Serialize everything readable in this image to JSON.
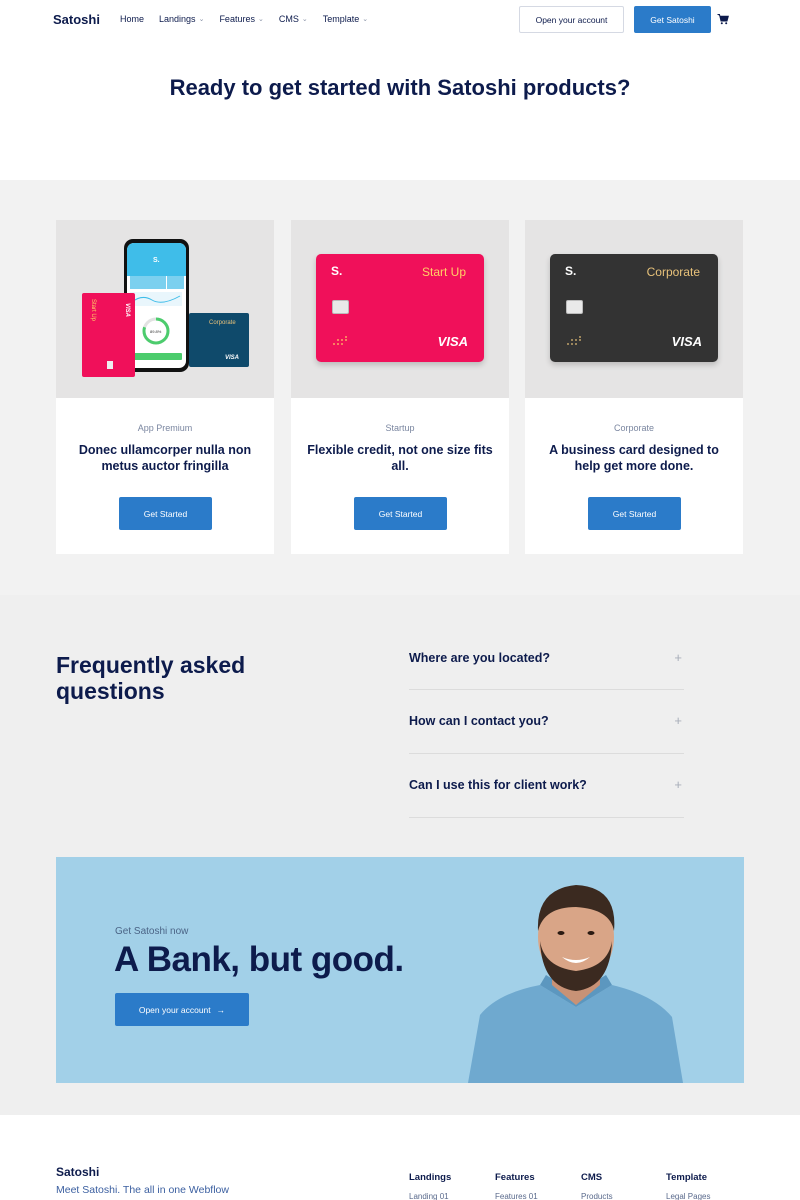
{
  "nav": {
    "brand": "Satoshi",
    "items": [
      {
        "label": "Home",
        "dropdown": false
      },
      {
        "label": "Landings",
        "dropdown": true
      },
      {
        "label": "Features",
        "dropdown": true
      },
      {
        "label": "CMS",
        "dropdown": true
      },
      {
        "label": "Template",
        "dropdown": true
      }
    ],
    "open_account": "Open your account",
    "get_satoshi": "Get Satoshi",
    "cart_icon": "cart-icon"
  },
  "hero": {
    "title": "Ready to get started with Satoshi products?"
  },
  "products": [
    {
      "eyebrow": "App Premium",
      "title": "Donec ullamcorper nulla non metus auctor fringilla",
      "button": "Get Started"
    },
    {
      "eyebrow": "Startup",
      "title": "Flexible credit, not one size fits all.",
      "button": "Get Started",
      "card": {
        "logo": "S.",
        "label": "Start Up",
        "network": "VISA",
        "color": "#f0105a",
        "label_color": "#ffd166"
      }
    },
    {
      "eyebrow": "Corporate",
      "title": "A business card designed to help get more done.",
      "button": "Get Started",
      "card": {
        "logo": "S.",
        "label": "Corporate",
        "network": "VISA",
        "color": "#333333",
        "label_color": "#e8c27a"
      }
    }
  ],
  "app_premium_image": {
    "phone_logo": "S.",
    "phone_percent": "89.8%",
    "pink_card_label": "Start Up",
    "pink_card_network": "VISA",
    "teal_card_label": "Corporate",
    "teal_card_network": "VISA"
  },
  "faq": {
    "title": "Frequently asked questions",
    "items": [
      {
        "question": "Where are you located?"
      },
      {
        "question": "How can I contact you?"
      },
      {
        "question": "Can I use this for client work?"
      }
    ],
    "expand_icon": "plus-icon"
  },
  "cta": {
    "eyebrow": "Get Satoshi now",
    "title": "A Bank, but good.",
    "button": "Open your account",
    "arrow": "→"
  },
  "footer": {
    "brand": "Satoshi",
    "tagline": "Meet Satoshi. The all in one Webflow",
    "columns": [
      {
        "heading": "Landings",
        "first_link": "Landing 01"
      },
      {
        "heading": "Features",
        "first_link": "Features 01"
      },
      {
        "heading": "CMS",
        "first_link": "Products"
      },
      {
        "heading": "Template",
        "first_link": "Legal Pages"
      }
    ]
  }
}
